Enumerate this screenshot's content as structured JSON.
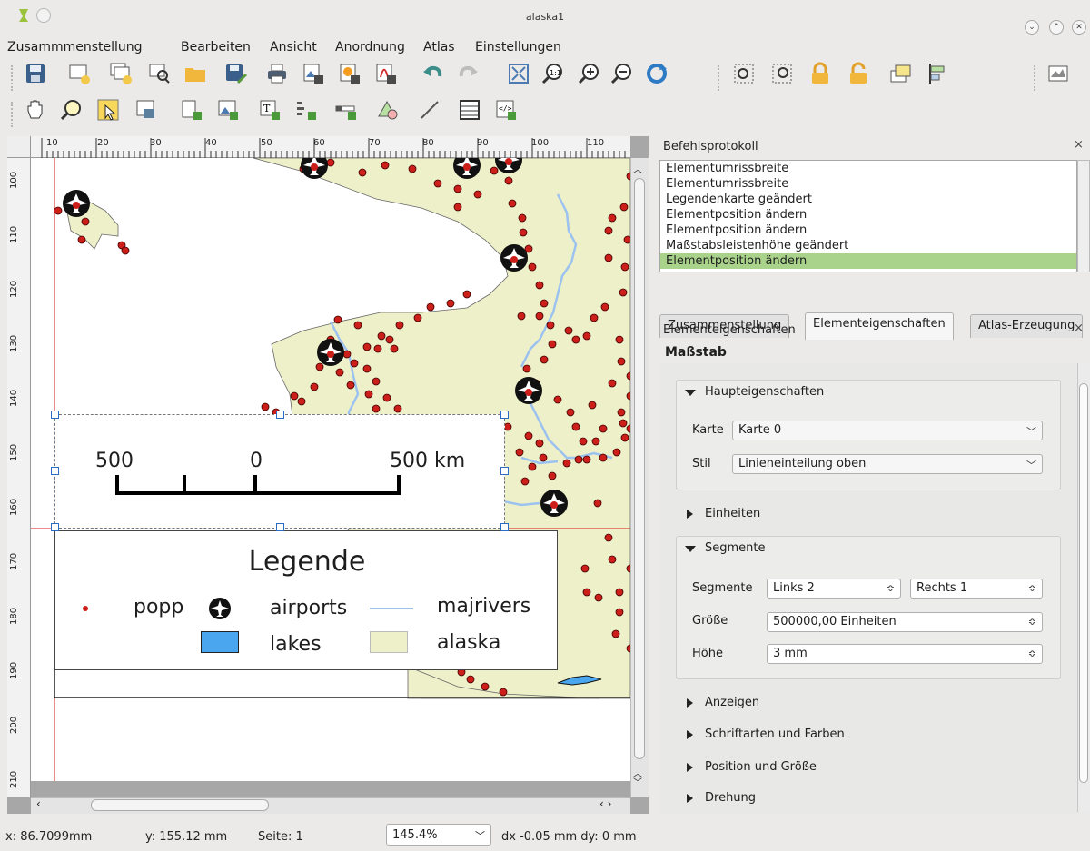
{
  "window": {
    "title": "alaska1",
    "buttons": {
      "minimize": "⌄",
      "maximize": "⌃",
      "close": "✕"
    }
  },
  "menu": [
    "Zusammmenstellung",
    "Bearbeiten",
    "Ansicht",
    "Anordnung",
    "Atlas",
    "Einstellungen"
  ],
  "toolbar1_icons": [
    "save-icon",
    "new-composer-icon",
    "duplicate-composer-icon",
    "composer-manager-icon",
    "open-template-icon",
    "save-template-icon",
    "print-icon",
    "export-image-icon",
    "export-svg-icon",
    "export-pdf-icon",
    "undo-icon",
    "redo-icon",
    "zoom-full-icon",
    "zoom-actual-icon",
    "zoom-in-icon",
    "zoom-out-icon",
    "refresh-icon",
    "group-icon",
    "ungroup-icon",
    "lock-icon",
    "unlock-icon",
    "raise-icon",
    "align-icon",
    "atlas-settings-icon"
  ],
  "toolbar2_icons": [
    "pan-icon",
    "zoom-tool-icon",
    "select-icon",
    "move-content-icon",
    "add-map-icon",
    "add-image-icon",
    "add-label-icon",
    "add-legend-icon",
    "add-scalebar-icon",
    "add-shape-icon",
    "add-arrow-icon",
    "add-table-icon",
    "add-html-icon"
  ],
  "ruler": {
    "top": [
      "10",
      "20",
      "30",
      "40",
      "50",
      "60",
      "70",
      "80",
      "90",
      "100",
      "110"
    ],
    "left": [
      "100",
      "110",
      "120",
      "130",
      "140",
      "150",
      "160",
      "170",
      "180",
      "190",
      "200",
      "210"
    ]
  },
  "composer": {
    "scalebar": {
      "labels": [
        "500",
        "0",
        "500 km"
      ]
    },
    "legend": {
      "title": "Legende",
      "items": {
        "popp": "popp",
        "airports": "airports",
        "majrivers": "majrivers",
        "lakes": "lakes",
        "alaska": "alaska"
      }
    }
  },
  "colors": {
    "land": "#eef0c9",
    "rivers": "#9cc2f0",
    "points": "#cc1f1a",
    "lakes": "#4aa6ef",
    "selected_history": "#a9d38a",
    "guide": "#d11a1a"
  },
  "history_panel": {
    "title": "Befehlsprotokoll",
    "items": [
      "Elementumrissbreite",
      "Elementumrissbreite",
      "Legendenkarte geändert",
      "Elementposition ändern",
      "Elementposition ändern",
      "Maßstabsleistenhöhe geändert",
      "Elementposition ändern"
    ],
    "selected_index": 6
  },
  "tabs": [
    "Zusammenstellung",
    "Elementeigenschaften",
    "Atlas-Erzeugung"
  ],
  "properties": {
    "panel_title": "Elementeigenschaften",
    "item_type": "Maßstab",
    "main_group": "Haupteigenschaften",
    "karte_label": "Karte",
    "karte_value": "Karte 0",
    "stil_label": "Stil",
    "stil_value": "Linieneinteilung oben",
    "units_group": "Einheiten",
    "segments_group": "Segmente",
    "segments_label": "Segmente",
    "segments_left": "Links 2",
    "segments_right": "Rechts 1",
    "size_label": "Größe",
    "size_value": "500000,00 Einheiten",
    "height_label": "Höhe",
    "height_value": "3 mm",
    "display_group": "Anzeigen",
    "fonts_group": "Schriftarten und Farben",
    "position_group": "Position und Größe",
    "rotation_group": "Drehung"
  },
  "status": {
    "x": "x: 86.7099mm",
    "y": "y: 155.12 mm",
    "page": "Seite: 1",
    "zoom": "145.4%",
    "delta": "dx -0.05 mm dy: 0 mm"
  }
}
